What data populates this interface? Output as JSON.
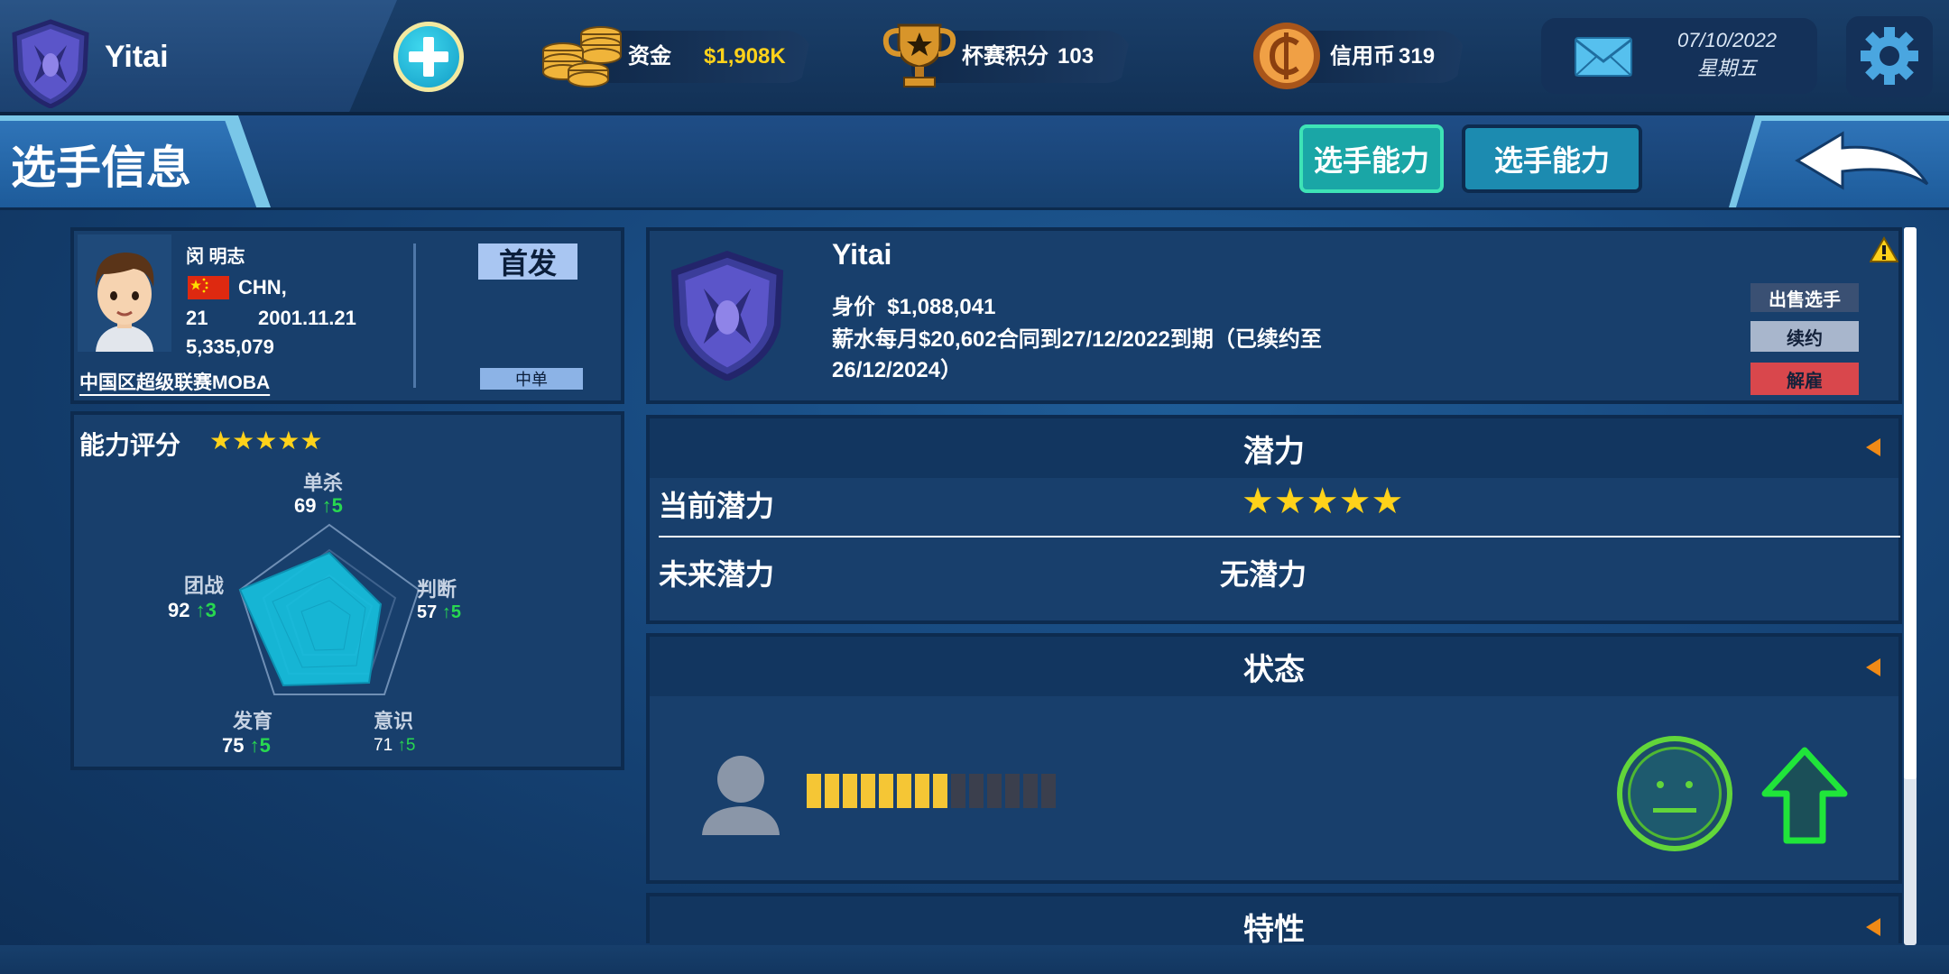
{
  "topbar": {
    "team_name": "Yitai",
    "funds_label": "资金",
    "funds_value": "$1,908K",
    "cup_label": "杯赛积分",
    "cup_value": "103",
    "credit_label": "信用币",
    "credit_value": "319",
    "date": "07/10/2022",
    "weekday": "星期五"
  },
  "header": {
    "title": "选手信息",
    "tab1": "选手能力",
    "tab2": "选手能力"
  },
  "player": {
    "name": "闵 明志",
    "nationality": "CHN,",
    "age": "21",
    "birthdate": "2001.11.21",
    "number": "5,335,079",
    "league": "中国区超级联赛MOBA",
    "starter": "首发",
    "position": "中单"
  },
  "rating": {
    "title": "能力评分",
    "stars": 5,
    "stats": [
      {
        "name": "单杀",
        "value": "69",
        "delta": "5"
      },
      {
        "name": "判断",
        "value": "57",
        "delta": "5"
      },
      {
        "name": "意识",
        "value": "71",
        "delta": "5"
      },
      {
        "name": "发育",
        "value": "75",
        "delta": "5"
      },
      {
        "name": "团战",
        "value": "92",
        "delta": "3"
      }
    ]
  },
  "contract": {
    "team": "Yitai",
    "value_label": "身价",
    "value": "$1,088,041",
    "salary_line1": "薪水每月$20,602合同到27/12/2022到期（已续约至",
    "salary_line2": "26/12/2024）",
    "sell_btn": "出售选手",
    "renew_btn": "续约",
    "release_btn": "解雇"
  },
  "potential": {
    "title": "潜力",
    "current_label": "当前潜力",
    "current_stars": 5,
    "future_label": "未来潜力",
    "future_value": "无潜力"
  },
  "status": {
    "title": "状态",
    "energy_filled": 8,
    "energy_total": 14
  },
  "traits": {
    "title": "特性"
  },
  "colors": {
    "accent_green": "#28d850",
    "gold": "#ffd21a",
    "release_red": "#d9474c",
    "radar_fill": "#16c2e0"
  }
}
